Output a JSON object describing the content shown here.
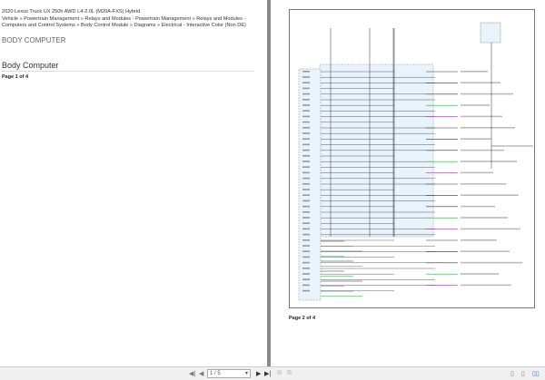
{
  "document": {
    "vehicle": "2020 Lexus Truck UX 250h AWD L4-2.0L (M20A-FXS) Hybrid",
    "breadcrumb_line1": "Vehicle » Powertrain Management » Relays and Modules - Powertrain Management » Relays and Modules -",
    "breadcrumb_line2": "Computers and Control Systems » Body Control Module » Diagrams » Electrical - Interactive Color (Non DE)",
    "section": "BODY COMPUTER",
    "heading": "Body Computer",
    "page_left": "Page 1 of 4",
    "page_right": "Page 2 of 4"
  },
  "colors": {
    "wire_green": "#2aa84a",
    "wire_purple": "#9b3fb5",
    "wire_pink": "#d43f8d",
    "wire_teal": "#1fa3a3",
    "module_fill": "#e8f3fb"
  },
  "toolbar": {
    "page_value": "1 / 5",
    "icons": [
      "first-page-icon",
      "prev-page-icon",
      "next-page-icon",
      "last-page-icon",
      "fit-page-icon",
      "fit-width-icon",
      "single-page-icon",
      "continuous-icon",
      "two-page-icon"
    ]
  }
}
